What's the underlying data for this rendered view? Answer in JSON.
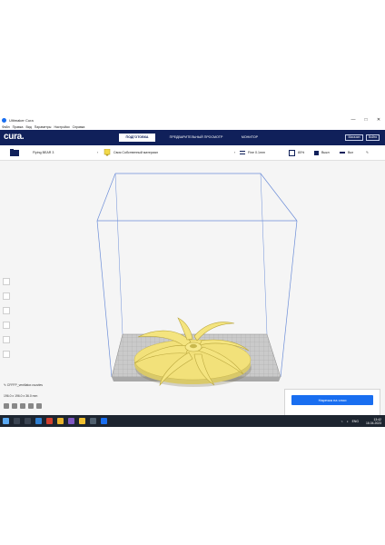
{
  "window": {
    "title": "Ultimaker Cura",
    "controls": [
      "—",
      "□",
      "✕"
    ]
  },
  "menu": [
    "Файл",
    "Правка",
    "Вид",
    "Параметры",
    "Настройки",
    "Справка"
  ],
  "header": {
    "brand": "cura.",
    "stages": [
      "ПОДГОТОВКА",
      "ПРЕДВАРИТЕЛЬНЫЙ ПРОСМОТР",
      "МОНИТОР"
    ],
    "marketplace": "Магазин",
    "login": "Войти"
  },
  "toolbar": {
    "printer": "Flying BEAR 3",
    "material": "Своя Собственный материал",
    "profile": "Fine 0.1mm",
    "infill": "80%",
    "support": "Выкл",
    "adhesion": "Вкл"
  },
  "object": {
    "name": "CFFFP_ventilator-nozzles",
    "dimensions": "196.0 x 196.0 x 36.0 mm"
  },
  "action": {
    "slice_label": "Нарезка на слои"
  },
  "taskbar": {
    "lang": "ENG",
    "time": "13:42",
    "date": "16.04.2023"
  },
  "colors": {
    "header": "#10205a",
    "accent": "#196ef0",
    "model": "#f2e17a",
    "bed": "#c9c9c9"
  }
}
